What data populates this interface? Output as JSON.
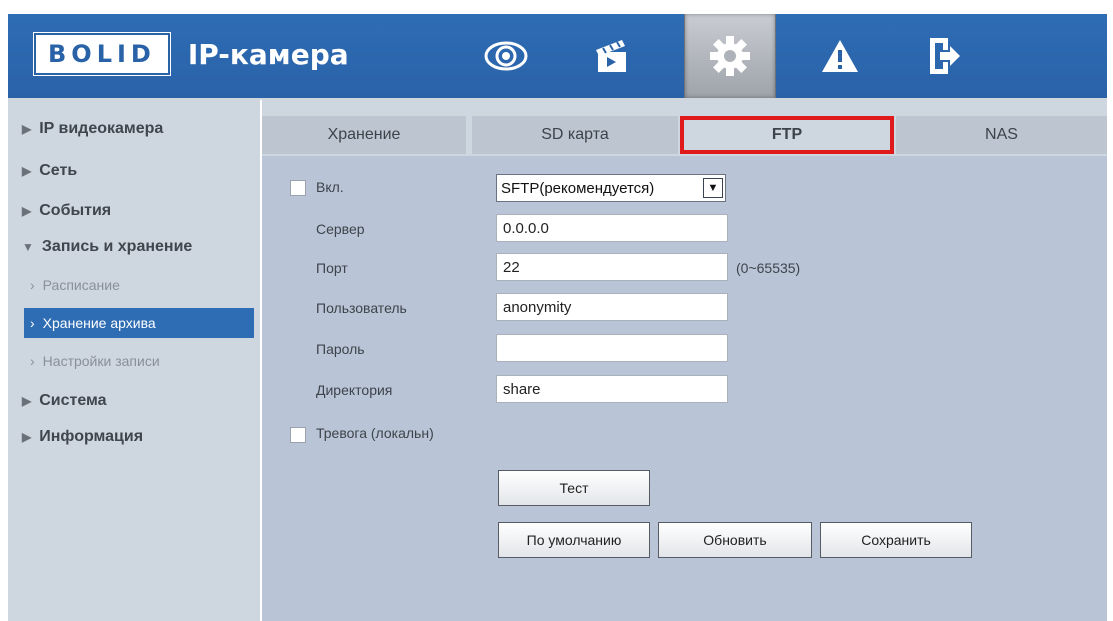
{
  "header": {
    "brand": "BOLID",
    "title": "IP-камера",
    "icons": [
      "eye-icon",
      "clapperboard-icon",
      "gear-icon",
      "warning-icon",
      "exit-icon"
    ],
    "active_icon": "gear-icon"
  },
  "sidebar": {
    "items": [
      {
        "label": "IP видеокамера"
      },
      {
        "label": "Сеть"
      },
      {
        "label": "События"
      },
      {
        "label": "Запись и хранение"
      },
      {
        "label": "Расписание"
      },
      {
        "label": "Хранение архива"
      },
      {
        "label": "Настройки записи"
      },
      {
        "label": "Система"
      },
      {
        "label": "Информация"
      }
    ]
  },
  "tabs": [
    {
      "label": "Хранение"
    },
    {
      "label": "SD карта"
    },
    {
      "label": "FTP"
    },
    {
      "label": "NAS"
    }
  ],
  "form": {
    "enable_label": "Вкл.",
    "protocol_value": "SFTP(рекомендуется)",
    "server_label": "Сервер",
    "server_value": "0.0.0.0",
    "port_label": "Порт",
    "port_value": "22",
    "port_hint": "(0~65535)",
    "user_label": "Пользователь",
    "user_value": "anonymity",
    "password_label": "Пароль",
    "password_value": "",
    "dir_label": "Директория",
    "dir_value": "share",
    "alarm_label": "Тревога (локальн)"
  },
  "buttons": {
    "test": "Тест",
    "default": "По умолчанию",
    "refresh": "Обновить",
    "save": "Сохранить"
  },
  "colors": {
    "header_blue": "#2a62a8",
    "active_tab_outline": "#e01a1a",
    "selected_item": "#2e6cb4"
  }
}
